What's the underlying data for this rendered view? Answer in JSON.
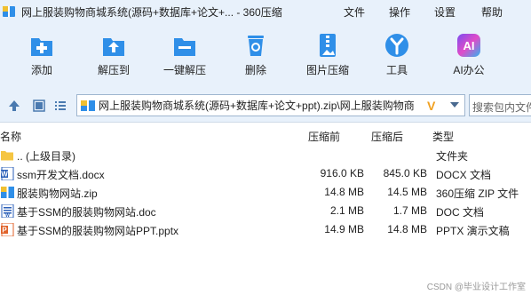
{
  "window": {
    "title": "网上服装购物商城系统(源码+数据库+论文+...  - 360压缩"
  },
  "menu": {
    "file": "文件",
    "operations": "操作",
    "settings": "设置",
    "help": "帮助"
  },
  "toolbar": {
    "add": "添加",
    "extract_to": "解压到",
    "one_click_extract": "一键解压",
    "delete": "删除",
    "image_compress": "图片压缩",
    "tools": "工具",
    "ai_office": "AI办公",
    "ai_badge": "AI"
  },
  "address": {
    "path": "网上服装购物商城系统(源码+数据库+论文+ppt).zip\\网上服装购物商",
    "v_mark": "V",
    "search_placeholder": "搜索包内文件"
  },
  "columns": {
    "name": "名称",
    "size": "压缩前",
    "compressed": "压缩后",
    "type": "类型"
  },
  "files": [
    {
      "name": ".. (上级目录)",
      "size": "",
      "compressed": "",
      "type": "文件夹",
      "icon": "folder-icon"
    },
    {
      "name": "ssm开发文档.docx",
      "size": "916.0 KB",
      "compressed": "845.0 KB",
      "type": "DOCX 文档",
      "icon": "word-icon"
    },
    {
      "name": "服装购物网站.zip",
      "size": "14.8 MB",
      "compressed": "14.5 MB",
      "type": "360压缩 ZIP 文件",
      "icon": "zip-icon"
    },
    {
      "name": "基于SSM的服装购物网站.doc",
      "size": "2.1 MB",
      "compressed": "1.7 MB",
      "type": "DOC 文档",
      "icon": "word-icon"
    },
    {
      "name": "基于SSM的服装购物网站PPT.pptx",
      "size": "14.9 MB",
      "compressed": "14.8 MB",
      "type": "PPTX 演示文稿",
      "icon": "ppt-icon"
    }
  ],
  "watermark": "CSDN @毕业设计工作室",
  "colors": {
    "toolbar_bg": "#e8f1fb",
    "icon_blue": "#2f8fe8",
    "accent_orange": "#f0a020",
    "ppt_orange": "#e0622a"
  }
}
